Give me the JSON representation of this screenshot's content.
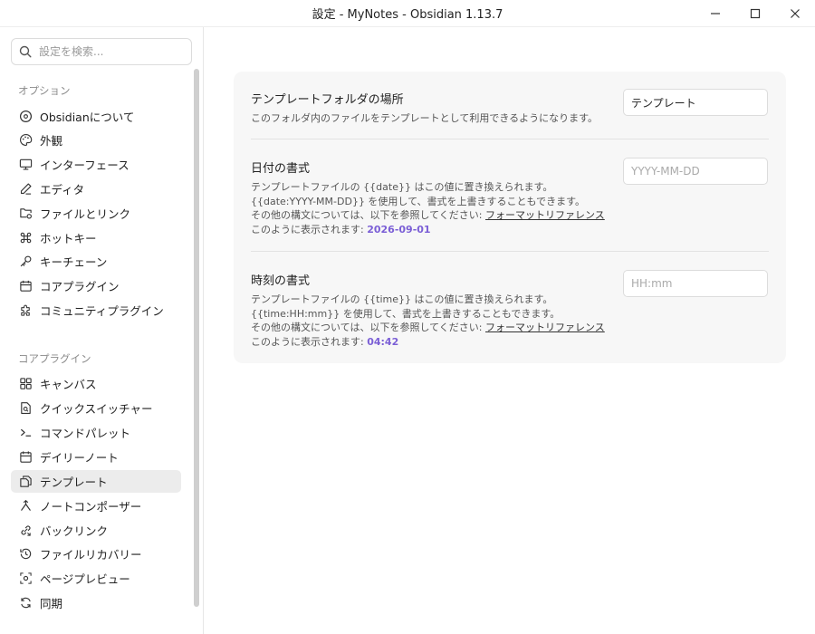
{
  "window": {
    "title": "設定 - MyNotes - Obsidian 1.13.7"
  },
  "sidebar": {
    "search_placeholder": "設定を検索...",
    "options_label": "オプション",
    "options": [
      {
        "label": "Obsidianについて",
        "icon": "info-circle-icon"
      },
      {
        "label": "外観",
        "icon": "palette-icon"
      },
      {
        "label": "インターフェース",
        "icon": "monitor-icon"
      },
      {
        "label": "エディタ",
        "icon": "pen-icon"
      },
      {
        "label": "ファイルとリンク",
        "icon": "folder-link-icon"
      },
      {
        "label": "ホットキー",
        "icon": "command-icon"
      },
      {
        "label": "キーチェーン",
        "icon": "key-icon"
      },
      {
        "label": "コアプラグイン",
        "icon": "calendar-plugin-icon"
      },
      {
        "label": "コミュニティプラグイン",
        "icon": "puzzle-icon"
      }
    ],
    "core_label": "コアプラグイン",
    "core_plugins": [
      {
        "label": "キャンバス",
        "icon": "canvas-grid-icon"
      },
      {
        "label": "クイックスイッチャー",
        "icon": "file-search-icon"
      },
      {
        "label": "コマンドパレット",
        "icon": "terminal-icon"
      },
      {
        "label": "デイリーノート",
        "icon": "calendar-icon"
      },
      {
        "label": "テンプレート",
        "icon": "copy-files-icon",
        "active": true
      },
      {
        "label": "ノートコンポーザー",
        "icon": "merge-icon"
      },
      {
        "label": "バックリンク",
        "icon": "backlink-icon"
      },
      {
        "label": "ファイルリカバリー",
        "icon": "history-icon"
      },
      {
        "label": "ページプレビュー",
        "icon": "preview-eye-icon"
      },
      {
        "label": "同期",
        "icon": "sync-icon"
      }
    ]
  },
  "settings": {
    "folder": {
      "name": "テンプレートフォルダの場所",
      "desc": "このフォルダ内のファイルをテンプレートとして利用できるようになります。",
      "value": "テンプレート"
    },
    "date": {
      "name": "日付の書式",
      "desc1": "テンプレートファイルの {{date}} はこの値に置き換えられます。",
      "desc2": "{{date:YYYY-MM-DD}} を使用して、書式を上書きすることもできます。",
      "desc3": "その他の構文については、以下を参照してください: ",
      "link": "フォーマットリファレンス",
      "preview_label": "このように表示されます: ",
      "preview_value": "2026-09-01",
      "placeholder": "YYYY-MM-DD"
    },
    "time": {
      "name": "時刻の書式",
      "desc1": "テンプレートファイルの {{time}} はこの値に置き換えられます。",
      "desc2": "{{time:HH:mm}} を使用して、書式を上書きすることもできます。",
      "desc3": "その他の構文については、以下を参照してください: ",
      "link": "フォーマットリファレンス",
      "preview_label": "このように表示されます: ",
      "preview_value": "04:42",
      "placeholder": "HH:mm"
    }
  }
}
